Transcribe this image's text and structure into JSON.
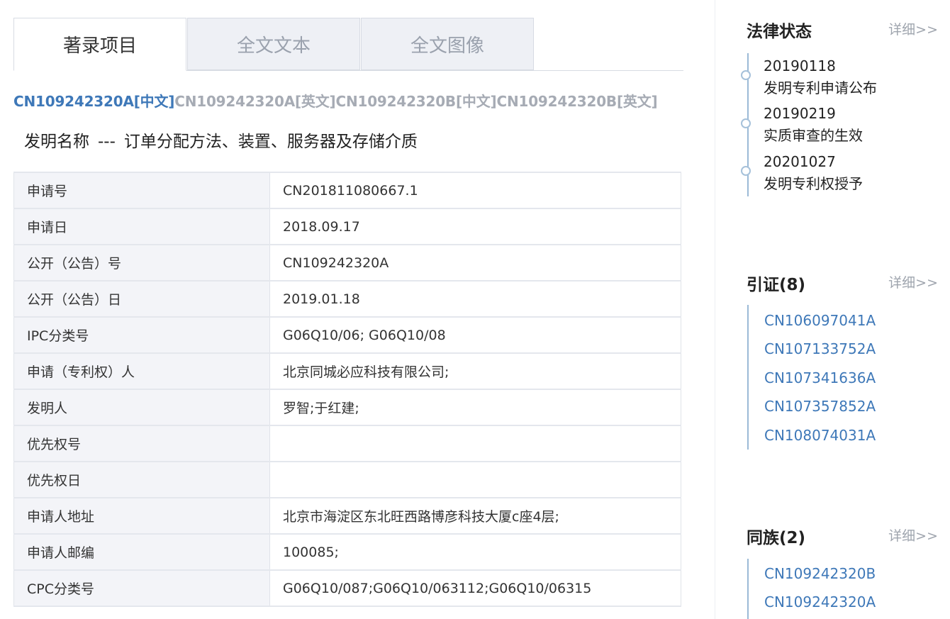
{
  "tabs": [
    {
      "label": "著录项目",
      "active": true
    },
    {
      "label": "全文文本",
      "active": false
    },
    {
      "label": "全文图像",
      "active": false
    }
  ],
  "doc_links": [
    {
      "label": "CN109242320A[中文]",
      "active": true
    },
    {
      "label": "CN109242320A[英文]",
      "active": false
    },
    {
      "label": "CN109242320B[中文]",
      "active": false
    },
    {
      "label": "CN109242320B[英文]",
      "active": false
    }
  ],
  "invention": {
    "label": "发明名称",
    "separator": "---",
    "title": "订单分配方法、装置、服务器及存储介质"
  },
  "fields": [
    {
      "label": "申请号",
      "value": "CN201811080667.1"
    },
    {
      "label": "申请日",
      "value": "2018.09.17"
    },
    {
      "label": "公开（公告）号",
      "value": "CN109242320A"
    },
    {
      "label": "公开（公告）日",
      "value": "2019.01.18"
    },
    {
      "label": "IPC分类号",
      "value": "G06Q10/06; G06Q10/08"
    },
    {
      "label": "申请（专利权）人",
      "value": "北京同城必应科技有限公司;"
    },
    {
      "label": "发明人",
      "value": "罗智;于红建;"
    },
    {
      "label": "优先权号",
      "value": ""
    },
    {
      "label": "优先权日",
      "value": ""
    },
    {
      "label": "申请人地址",
      "value": "北京市海淀区东北旺西路博彦科技大厦c座4层;"
    },
    {
      "label": "申请人邮编",
      "value": "100085;"
    },
    {
      "label": "CPC分类号",
      "value": "G06Q10/087;G06Q10/063112;G06Q10/06315"
    }
  ],
  "legal_status": {
    "title": "法律状态",
    "more": "详细>>",
    "events": [
      {
        "date": "20190118",
        "desc": "发明专利申请公布"
      },
      {
        "date": "20190219",
        "desc": "实质审查的生效"
      },
      {
        "date": "20201027",
        "desc": "发明专利权授予"
      }
    ]
  },
  "citations": {
    "title": "引证(8)",
    "more": "详细>>",
    "items": [
      "CN106097041A",
      "CN107133752A",
      "CN107341636A",
      "CN107357852A",
      "CN108074031A"
    ]
  },
  "family": {
    "title": "同族(2)",
    "more": "详细>>",
    "items": [
      "CN109242320B",
      "CN109242320A"
    ]
  }
}
